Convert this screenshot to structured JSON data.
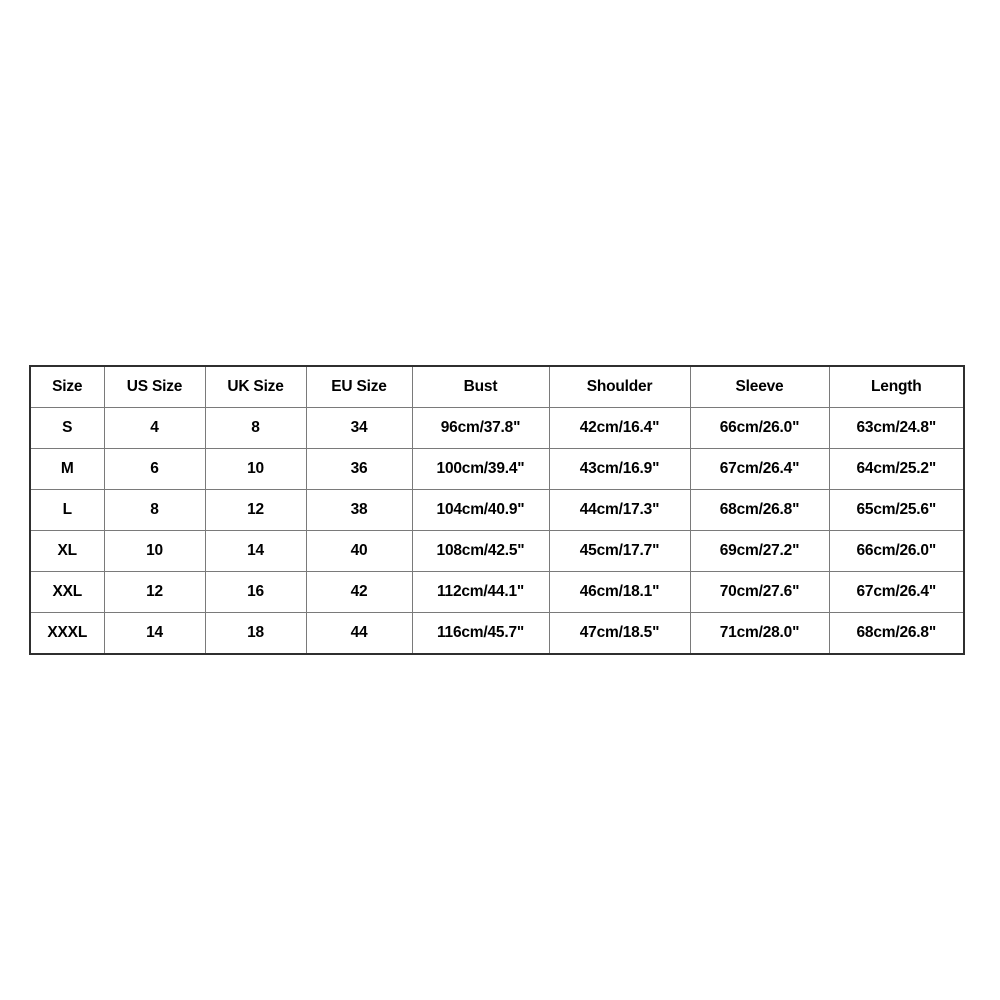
{
  "table": {
    "headers": [
      "Size",
      "US Size",
      "UK Size",
      "EU Size",
      "Bust",
      "Shoulder",
      "Sleeve",
      "Length"
    ],
    "rows": [
      {
        "size": "S",
        "us_size": "4",
        "uk_size": "8",
        "eu_size": "34",
        "bust": "96cm/37.8\"",
        "shoulder": "42cm/16.4\"",
        "sleeve": "66cm/26.0\"",
        "length": "63cm/24.8\""
      },
      {
        "size": "M",
        "us_size": "6",
        "uk_size": "10",
        "eu_size": "36",
        "bust": "100cm/39.4\"",
        "shoulder": "43cm/16.9\"",
        "sleeve": "67cm/26.4\"",
        "length": "64cm/25.2\""
      },
      {
        "size": "L",
        "us_size": "8",
        "uk_size": "12",
        "eu_size": "38",
        "bust": "104cm/40.9\"",
        "shoulder": "44cm/17.3\"",
        "sleeve": "68cm/26.8\"",
        "length": "65cm/25.6\""
      },
      {
        "size": "XL",
        "us_size": "10",
        "uk_size": "14",
        "eu_size": "40",
        "bust": "108cm/42.5\"",
        "shoulder": "45cm/17.7\"",
        "sleeve": "69cm/27.2\"",
        "length": "66cm/26.0\""
      },
      {
        "size": "XXL",
        "us_size": "12",
        "uk_size": "16",
        "eu_size": "42",
        "bust": "112cm/44.1\"",
        "shoulder": "46cm/18.1\"",
        "sleeve": "70cm/27.6\"",
        "length": "67cm/26.4\""
      },
      {
        "size": "XXXL",
        "us_size": "14",
        "uk_size": "18",
        "eu_size": "44",
        "bust": "116cm/45.7\"",
        "shoulder": "47cm/18.5\"",
        "sleeve": "71cm/28.0\"",
        "length": "68cm/26.8\""
      }
    ]
  },
  "colors": {
    "page_background": "#ffffff",
    "cell_background": "#ffffff",
    "inner_border": "#7a7a7a",
    "outer_border": "#2f2f2f",
    "text": "#000000"
  },
  "chart_data": {
    "type": "table",
    "title": "",
    "columns": [
      "Size",
      "US Size",
      "UK Size",
      "EU Size",
      "Bust",
      "Shoulder",
      "Sleeve",
      "Length"
    ],
    "rows": [
      [
        "S",
        "4",
        "8",
        "34",
        "96cm/37.8\"",
        "42cm/16.4\"",
        "66cm/26.0\"",
        "63cm/24.8\""
      ],
      [
        "M",
        "6",
        "10",
        "36",
        "100cm/39.4\"",
        "43cm/16.9\"",
        "67cm/26.4\"",
        "64cm/25.2\""
      ],
      [
        "L",
        "8",
        "12",
        "38",
        "104cm/40.9\"",
        "44cm/17.3\"",
        "68cm/26.8\"",
        "65cm/25.6\""
      ],
      [
        "XL",
        "10",
        "14",
        "40",
        "108cm/42.5\"",
        "45cm/17.7\"",
        "69cm/27.2\"",
        "66cm/26.0\""
      ],
      [
        "XXL",
        "12",
        "16",
        "42",
        "112cm/44.1\"",
        "46cm/18.1\"",
        "70cm/27.6\"",
        "67cm/26.4\""
      ],
      [
        "XXXL",
        "14",
        "18",
        "44",
        "116cm/45.7\"",
        "47cm/18.5\"",
        "71cm/28.0\"",
        "68cm/26.8\""
      ]
    ]
  }
}
